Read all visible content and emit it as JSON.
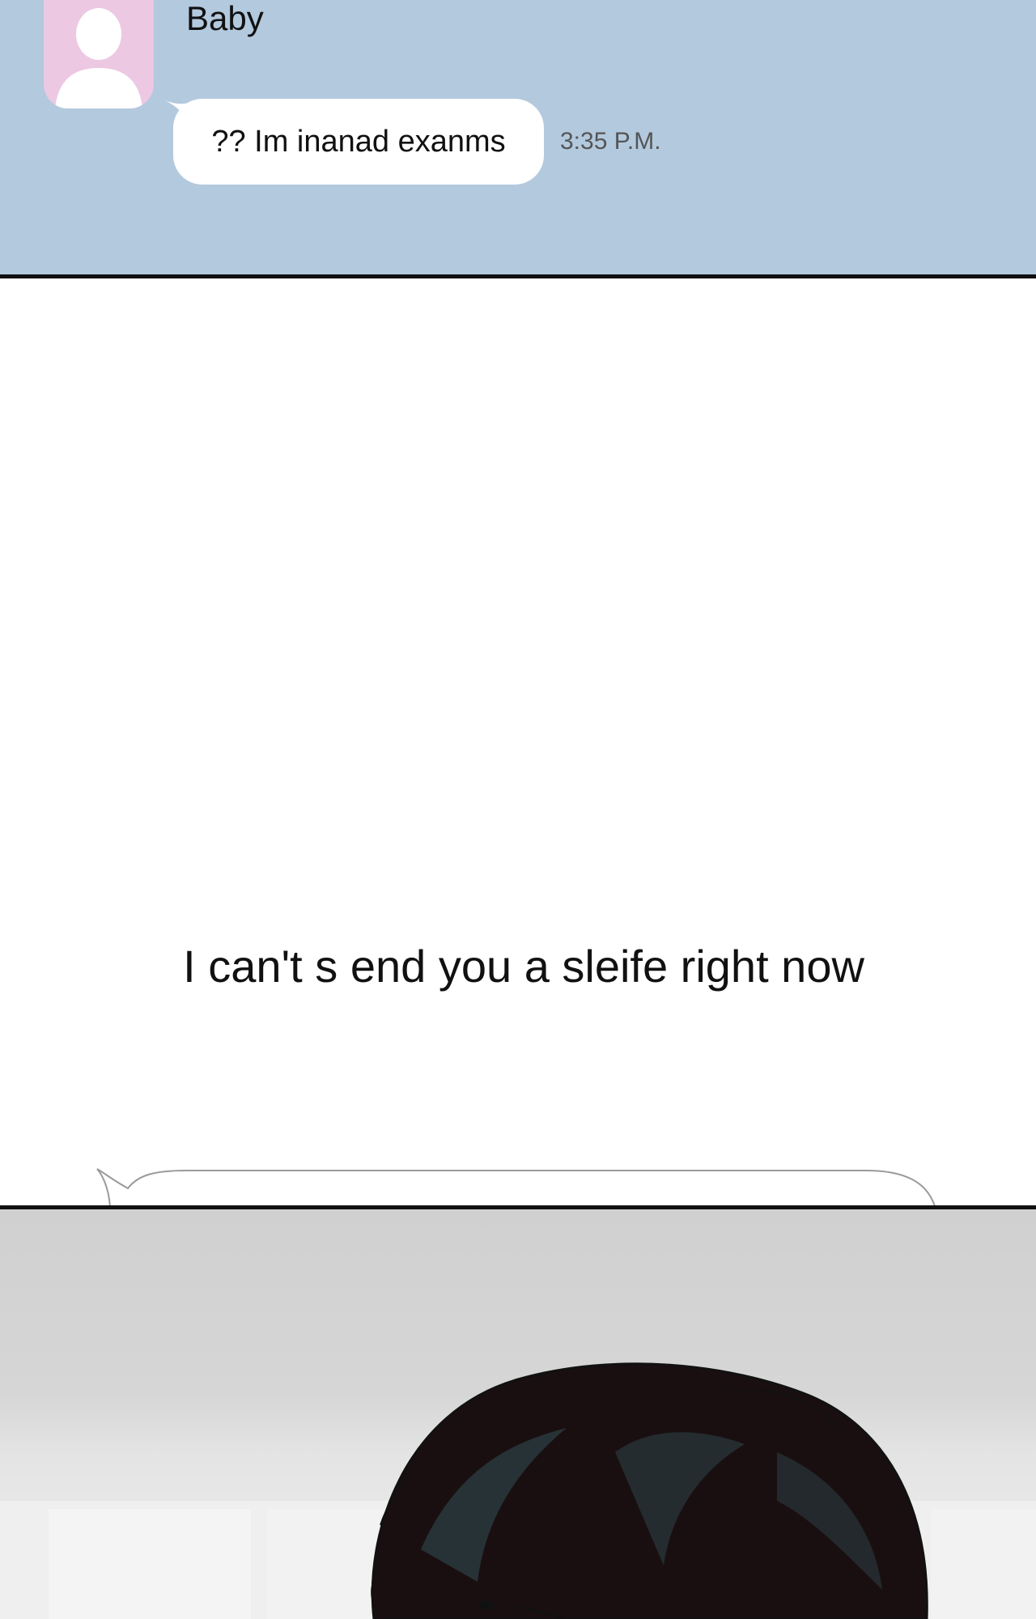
{
  "chat": {
    "contact_name": "Baby",
    "avatar_icon": "person-silhouette-icon",
    "message": "?? Im inanad exanms",
    "time": "3:35 P.M."
  },
  "speech": {
    "text": "I can't s end you a sleife right now"
  },
  "colors": {
    "chat_background": "#b3c9de",
    "avatar_background": "#ecc8e3",
    "panel_border": "#111111",
    "hair": "#1a0f10",
    "background_wall": "#d0d0d0"
  }
}
